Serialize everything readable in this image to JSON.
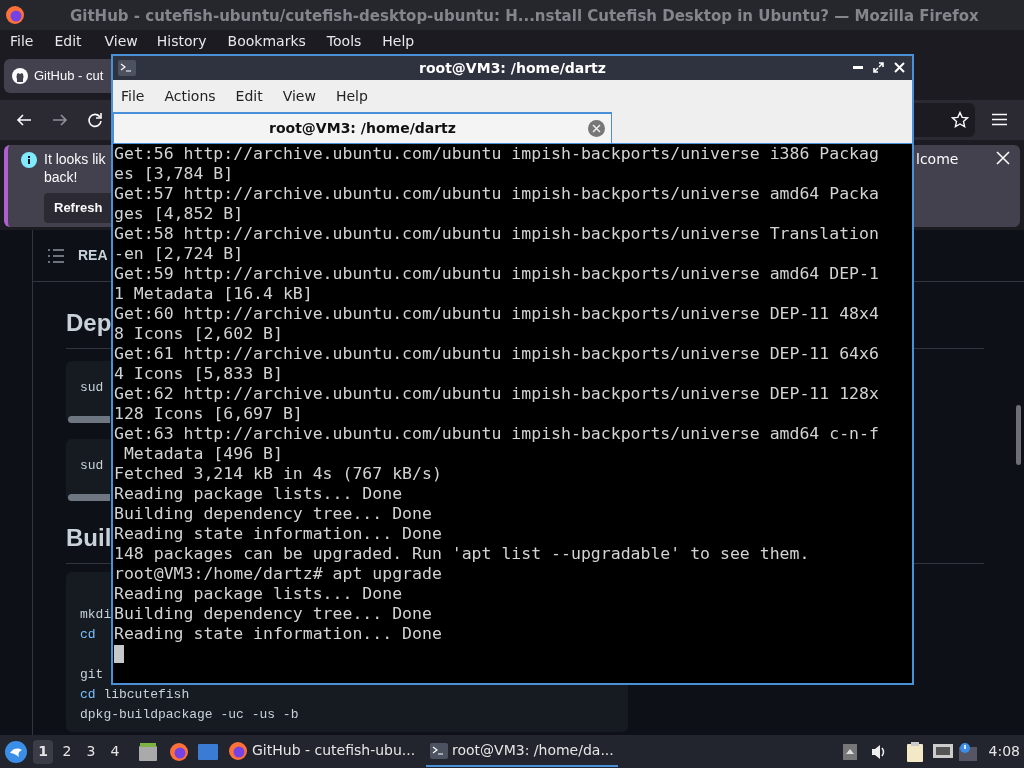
{
  "browser": {
    "title": "GitHub - cutefish-ubuntu/cutefish-desktop-ubuntu: H...nstall Cutefish Desktop in Ubuntu? — Mozilla Firefox",
    "menu": [
      "File",
      "Edit",
      "View",
      "History",
      "Bookmarks",
      "Tools",
      "Help"
    ],
    "tab": {
      "label": "GitHub - cut"
    },
    "notification": {
      "line_1": "It looks lik",
      "line_2": "back!",
      "button": "Refresh",
      "tail": "lcome"
    },
    "page": {
      "toc_label": "REA",
      "heading_1": "Dep",
      "code_blocks_1": [
        "sud",
        "sud"
      ],
      "heading_2": "Buil",
      "code_groups": [
        [
          {
            "tokens": [
              {
                "text": "mkdi",
                "kind": "plain"
              }
            ]
          },
          {
            "tokens": [
              {
                "text": "cd",
                "kind": "builtin"
              }
            ]
          }
        ],
        [
          {
            "tokens": [
              {
                "text": "git",
                "kind": "plain"
              }
            ]
          },
          {
            "tokens": [
              {
                "text": "cd",
                "kind": "builtin"
              },
              {
                "text": " libcutefish",
                "kind": "plain"
              }
            ]
          },
          {
            "tokens": [
              {
                "text": "dpkg-buildpackage -uc -us -b",
                "kind": "plain"
              }
            ]
          }
        ]
      ]
    }
  },
  "terminal": {
    "title": "root@VM3: /home/dartz",
    "menu": [
      "File",
      "Actions",
      "Edit",
      "View",
      "Help"
    ],
    "tab": "root@VM3: /home/dartz",
    "lines": [
      "Get:56 http://archive.ubuntu.com/ubuntu impish-backports/universe i386 Packag",
      "es [3,784 B]",
      "Get:57 http://archive.ubuntu.com/ubuntu impish-backports/universe amd64 Packa",
      "ges [4,852 B]",
      "Get:58 http://archive.ubuntu.com/ubuntu impish-backports/universe Translation",
      "-en [2,724 B]",
      "Get:59 http://archive.ubuntu.com/ubuntu impish-backports/universe amd64 DEP-1",
      "1 Metadata [16.4 kB]",
      "Get:60 http://archive.ubuntu.com/ubuntu impish-backports/universe DEP-11 48x4",
      "8 Icons [2,602 B]",
      "Get:61 http://archive.ubuntu.com/ubuntu impish-backports/universe DEP-11 64x6",
      "4 Icons [5,833 B]",
      "Get:62 http://archive.ubuntu.com/ubuntu impish-backports/universe DEP-11 128x",
      "128 Icons [6,697 B]",
      "Get:63 http://archive.ubuntu.com/ubuntu impish-backports/universe amd64 c-n-f",
      " Metadata [496 B]",
      "Fetched 3,214 kB in 4s (767 kB/s)",
      "Reading package lists... Done",
      "Building dependency tree... Done",
      "Reading state information... Done",
      "148 packages can be upgraded. Run 'apt list --upgradable' to see them.",
      "root@VM3:/home/dartz# apt upgrade",
      "Reading package lists... Done",
      "Building dependency tree... Done",
      "Reading state information... Done"
    ]
  },
  "taskbar": {
    "workspaces": [
      {
        "label": "1",
        "selected": true
      },
      {
        "label": "2",
        "selected": false
      },
      {
        "label": "3",
        "selected": false
      },
      {
        "label": "4",
        "selected": false
      }
    ],
    "tasks": [
      {
        "label": "GitHub - cutefish-ubu...",
        "kind": "browser",
        "selected": false
      },
      {
        "label": "root@VM3: /home/da...",
        "kind": "terminal",
        "selected": true
      }
    ],
    "clock": "4:08"
  }
}
